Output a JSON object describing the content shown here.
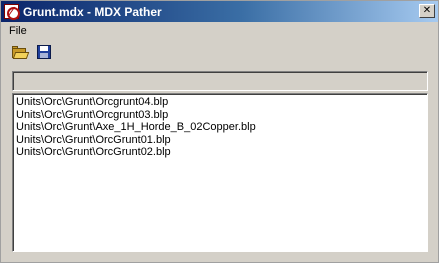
{
  "window": {
    "title": "Grunt.mdx - MDX Pather",
    "close_glyph": "✕"
  },
  "menu": {
    "items": [
      {
        "label": "File"
      }
    ]
  },
  "toolbar": {
    "buttons": [
      {
        "icon": "open-folder-icon"
      },
      {
        "icon": "save-disk-icon"
      }
    ]
  },
  "path_field": {
    "value": ""
  },
  "file_list": {
    "items": [
      "Units\\Orc\\Grunt\\Orcgrunt04.blp",
      "Units\\Orc\\Grunt\\Orcgrunt03.blp",
      "Units\\Orc\\Grunt\\Axe_1H_Horde_B_02Copper.blp",
      "Units\\Orc\\Grunt\\OrcGrunt01.blp",
      "Units\\Orc\\Grunt\\OrcGrunt02.blp"
    ]
  }
}
